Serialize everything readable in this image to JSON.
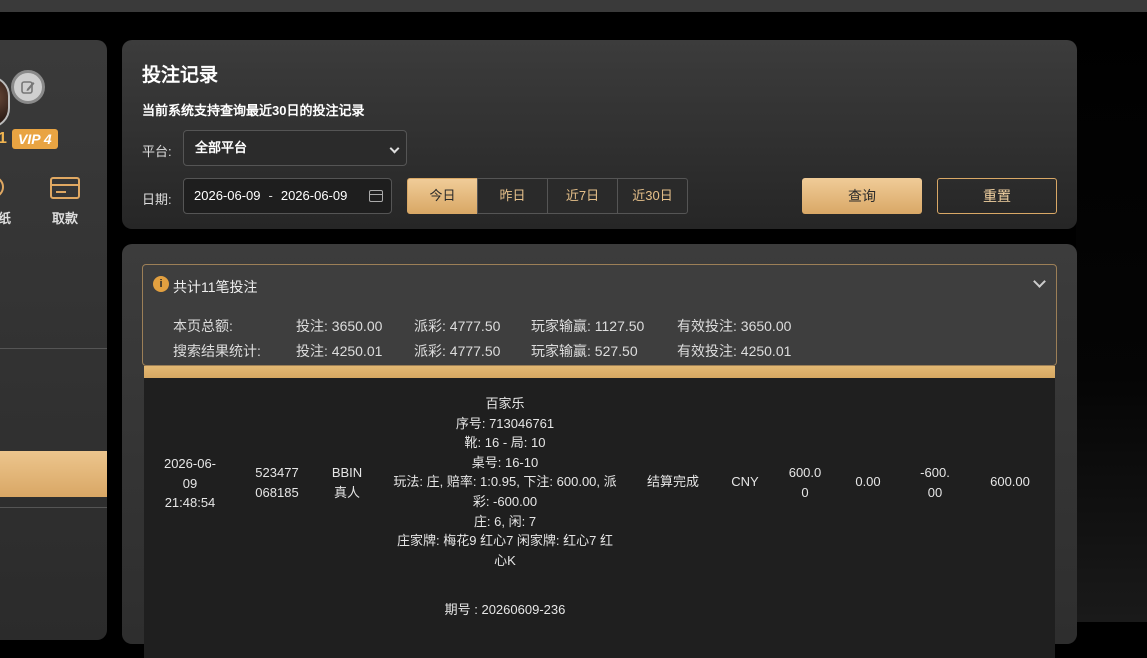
{
  "sidebar": {
    "vip": "VIP 4",
    "username_fragment": "1",
    "action_left_label": "纸",
    "action_withdraw_label": "取款"
  },
  "page": {
    "title": "投注记录",
    "subtitle": "当前系统支持查询最近30日的投注记录"
  },
  "filters": {
    "platform_label": "平台:",
    "platform_value": "全部平台",
    "date_label": "日期:",
    "date_start": "2026-06-09",
    "date_sep": "-",
    "date_end": "2026-06-09",
    "ranges": [
      "今日",
      "昨日",
      "近7日",
      "近30日"
    ],
    "active_range": "今日",
    "query_label": "查询",
    "reset_label": "重置"
  },
  "summary": {
    "total_text": "共计11笔投注",
    "page_total_label": "本页总额:",
    "search_stats_label": "搜索结果统计:",
    "page_total": {
      "bet": "投注: 3650.00",
      "payout": "派彩: 4777.50",
      "player_win": "玩家输赢: 1127.50",
      "valid_bet": "有效投注: 3650.00"
    },
    "search_total": {
      "bet": "投注: 4250.01",
      "payout": "派彩: 4777.50",
      "player_win": "玩家输赢: 527.50",
      "valid_bet": "有效投注: 4250.01"
    }
  },
  "rows": [
    {
      "time": [
        "2026-06-",
        "09",
        "21:48:54"
      ],
      "order_no": [
        "523477",
        "068185"
      ],
      "platform": [
        "BBIN",
        "真人"
      ],
      "details": [
        "百家乐",
        "序号: 713046761",
        "靴: 16 - 局: 10",
        "桌号: 16-10",
        "玩法: 庄, 赔率: 1:0.95, 下注: 600.00, 派",
        "彩: -600.00",
        "庄: 6, 闲: 7",
        "庄家牌: 梅花9 红心7 闲家牌: 红心7 红",
        "心K"
      ],
      "status": "结算完成",
      "currency": "CNY",
      "bet": [
        "600.0",
        "0"
      ],
      "payout": "0.00",
      "win": [
        "-600.",
        "00"
      ],
      "valid": "600.00"
    },
    {
      "details": [
        "期号 : 20260609-236"
      ]
    }
  ],
  "colors": {
    "accent": "#d9a866",
    "accent_light": "#f0cc98",
    "card_bg": "#3c3c3c",
    "table_bg": "#1f1f1f"
  }
}
